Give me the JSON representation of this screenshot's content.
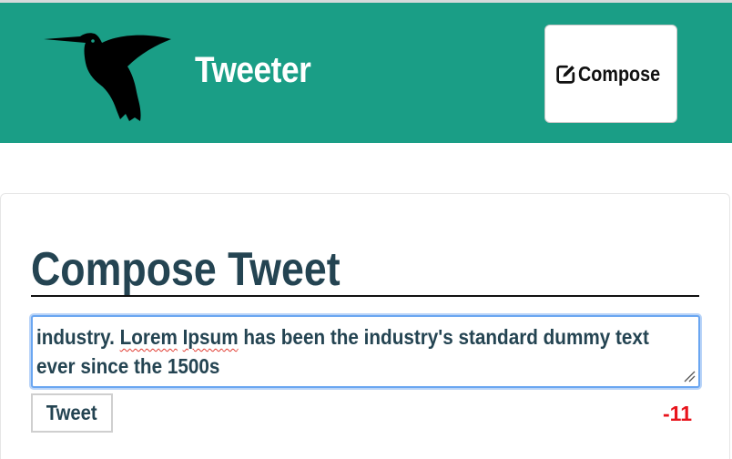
{
  "header": {
    "brand": "Tweeter",
    "logo_icon": "hummingbird-icon",
    "compose_button": {
      "icon": "edit-icon",
      "label": "Compose"
    },
    "background_color": "#1a9e86"
  },
  "compose": {
    "title": "Compose Tweet",
    "textarea": {
      "line1_prefix": "industry. ",
      "misspelled_1": "Lorem",
      "space": " ",
      "misspelled_2": "Ipsum",
      "line1_suffix": " has been the industry's standard dummy text",
      "line2": "ever since the 1500s"
    },
    "tweet_button_label": "Tweet",
    "char_counter": "-11",
    "counter_color": "#e8141c"
  }
}
